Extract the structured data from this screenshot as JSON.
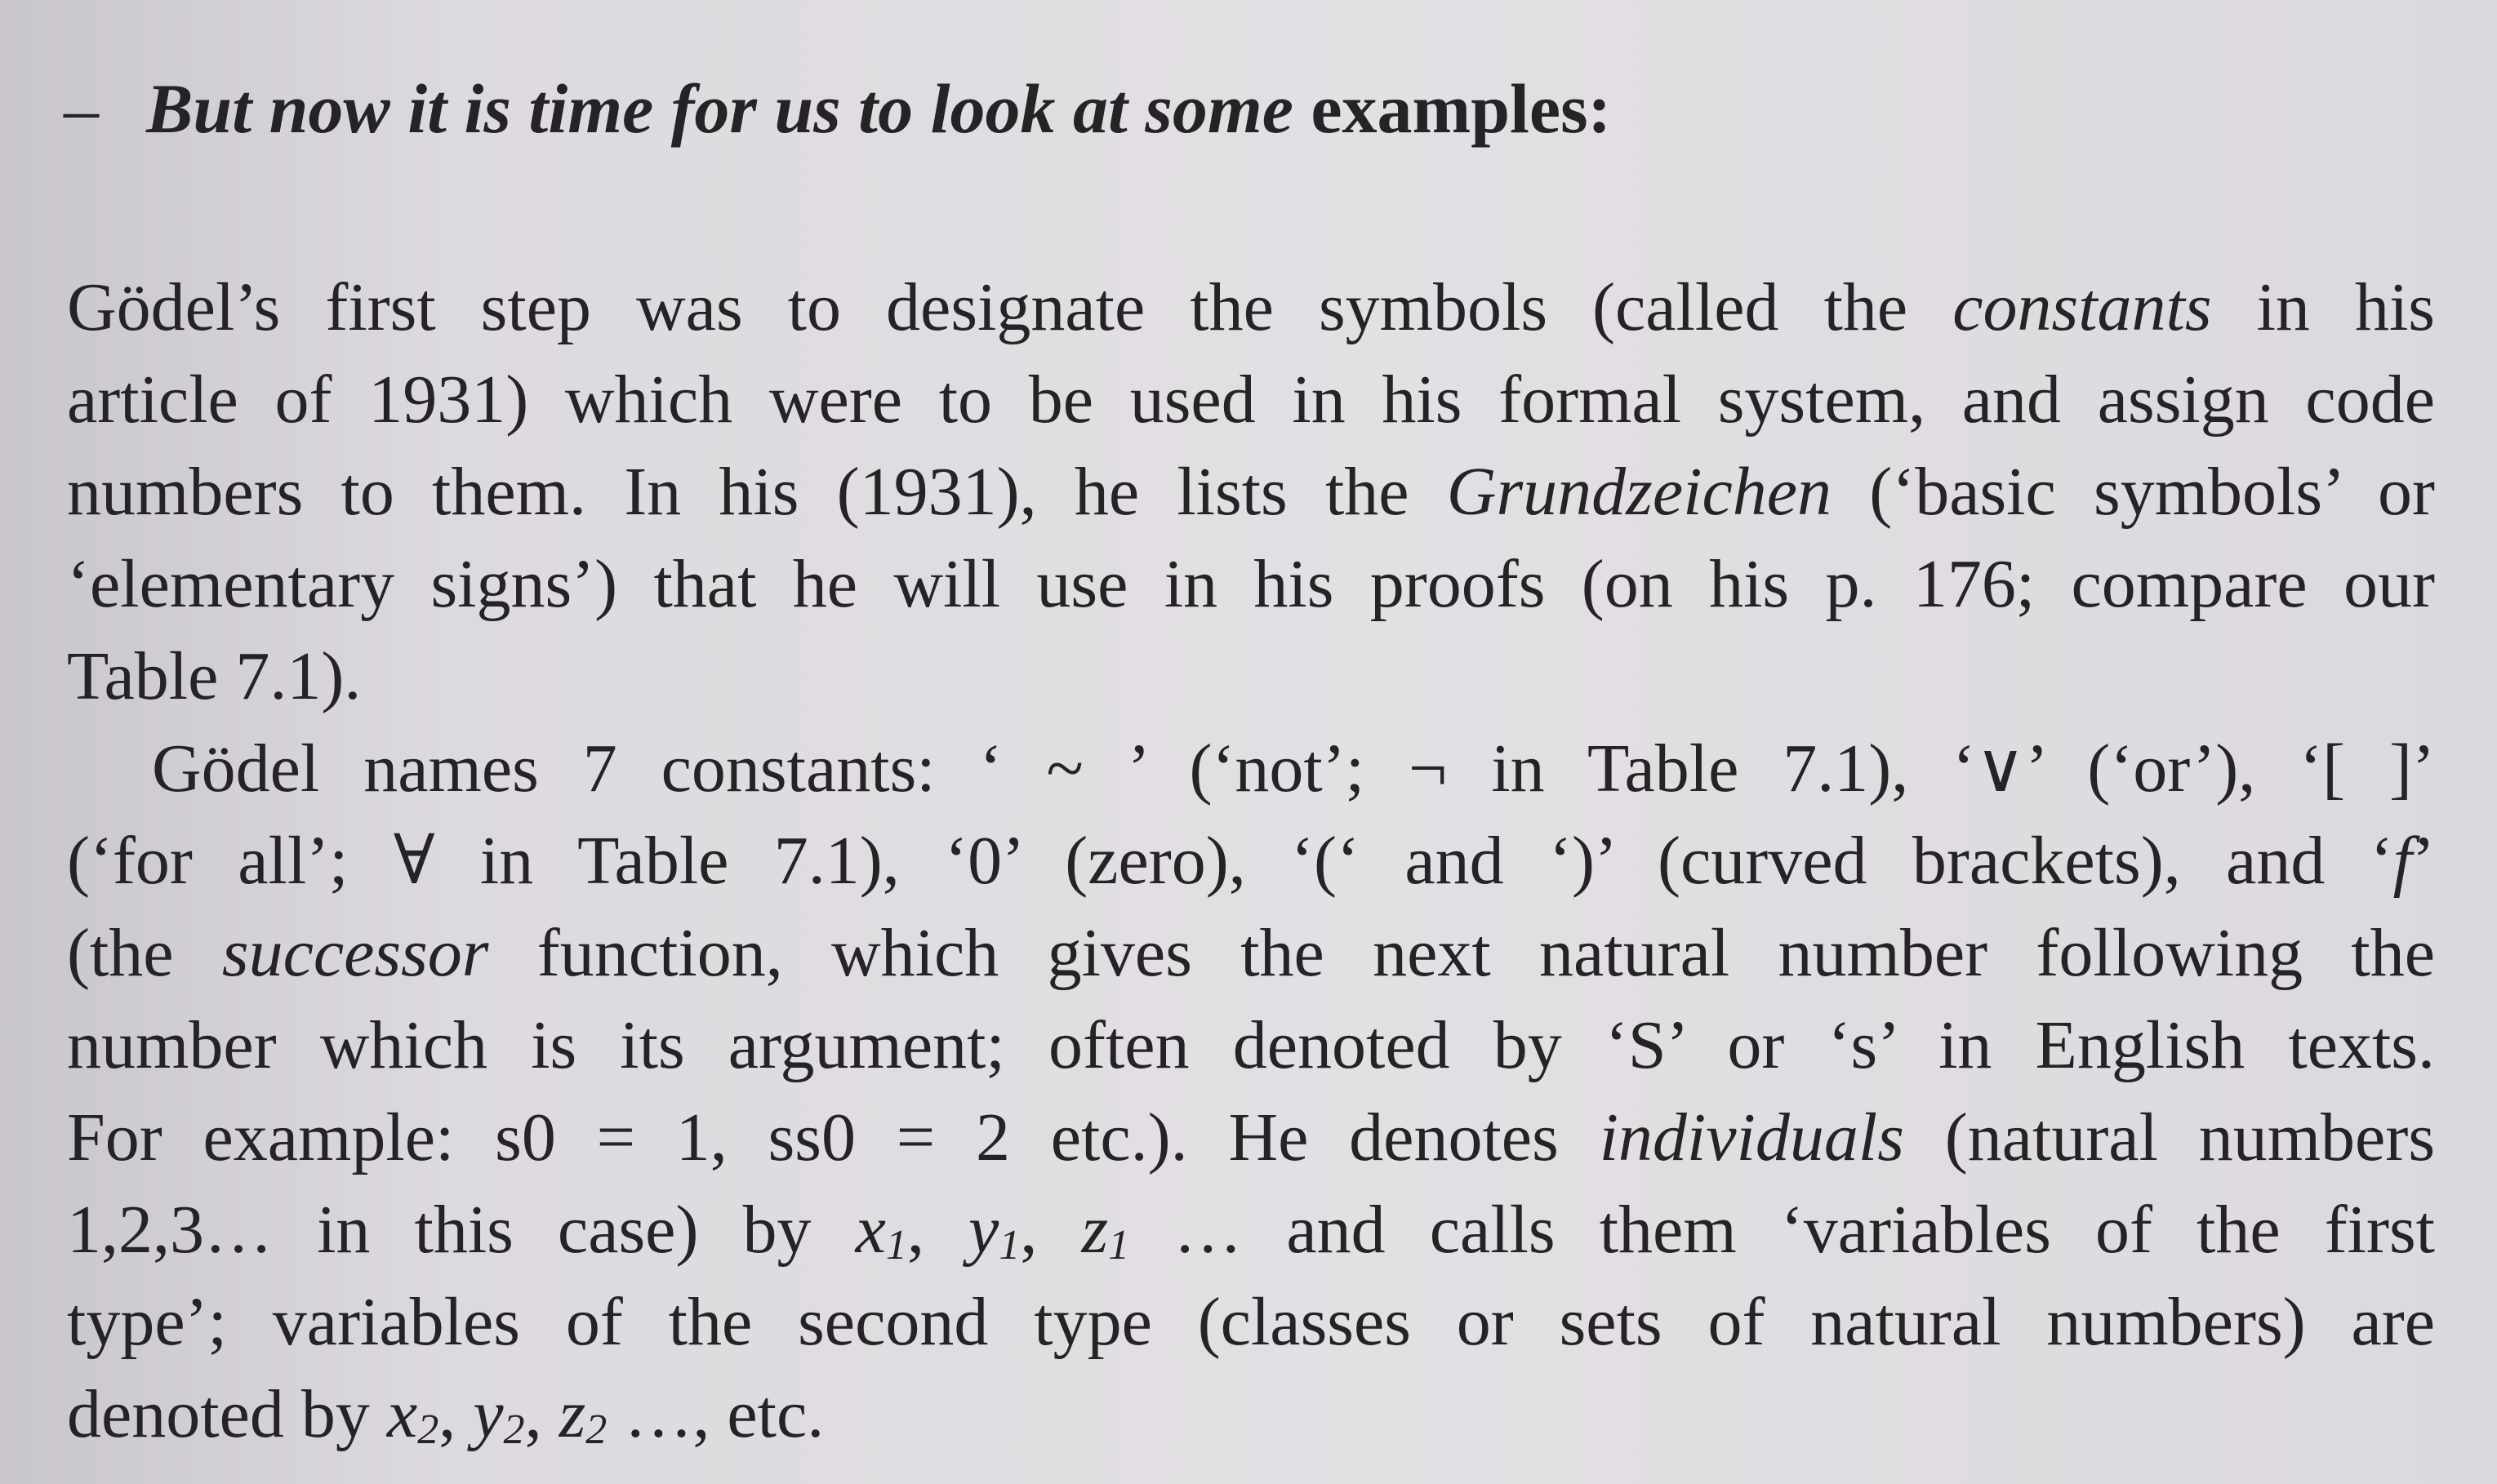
{
  "heading": {
    "dash": "–",
    "italic_part": "But now it is time for us to look at some",
    "plain_part": "examples:"
  },
  "paragraph1": {
    "l1_a": "Gödel’s first step was to designate the symbols (called the",
    "l1_it": "constants",
    "l1_b": "in his",
    "l2": "article of 1931) which were to be used in his formal system, and assign code",
    "l3_a": "numbers to them. In his (1931), he lists the",
    "l3_it": "Grundzeichen",
    "l3_b": "(‘basic symbols’ or",
    "l4": "‘elementary signs’) that he will use in his proofs (on his p. 176; compare our",
    "l5": "Table 7.1)."
  },
  "paragraph2": {
    "l1": "Gödel names 7 constants: ‘ ~ ’ (‘not’; ¬ in Table 7.1), ‘∨’ (‘or’), ‘[ ]’",
    "l2_a": "(‘for all’; ∀ in Table 7.1), ‘0’ (zero), ‘(‘ and ‘)’ (curved brackets), and ‘",
    "l2_it": "f",
    "l2_b": "’",
    "l3_a": "(the",
    "l3_it": "successor",
    "l3_b": "function, which gives the next natural number following the",
    "l4": "number which is its argument; often denoted by ‘S’ or ‘s’ in English texts.",
    "l5_a": "For example: s0 = 1, ss0 = 2 etc.). He denotes",
    "l5_it": "individuals",
    "l5_b": "(natural numbers",
    "l6_a": "1,2,3… in this case) by",
    "l6_x": "x",
    "l6_y": "y",
    "l6_z": "z",
    "l6_sub": "1",
    "l6_sep": ",",
    "l6_b": "… and calls them ‘variables of the first",
    "l7": "type’; variables of the second type (classes or sets of natural numbers) are",
    "l8_a": "denoted by",
    "l8_sub": "2",
    "l8_b": "…, etc."
  }
}
